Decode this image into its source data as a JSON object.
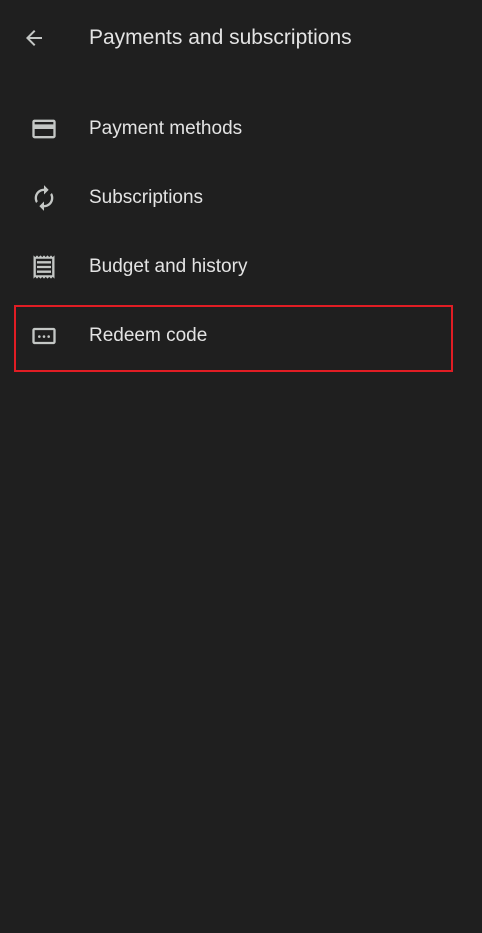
{
  "header": {
    "title": "Payments and subscriptions",
    "back_icon": "arrow-back-icon"
  },
  "menu": {
    "items": [
      {
        "label": "Payment methods",
        "icon": "credit-card-icon"
      },
      {
        "label": "Subscriptions",
        "icon": "autorenew-icon"
      },
      {
        "label": "Budget and history",
        "icon": "receipt-icon"
      },
      {
        "label": "Redeem code",
        "icon": "redeem-code-icon"
      }
    ]
  },
  "colors": {
    "background": "#1f1f1f",
    "text": "#e3e3e3",
    "icon": "#c4c7c5",
    "highlight": "#e01d24"
  }
}
